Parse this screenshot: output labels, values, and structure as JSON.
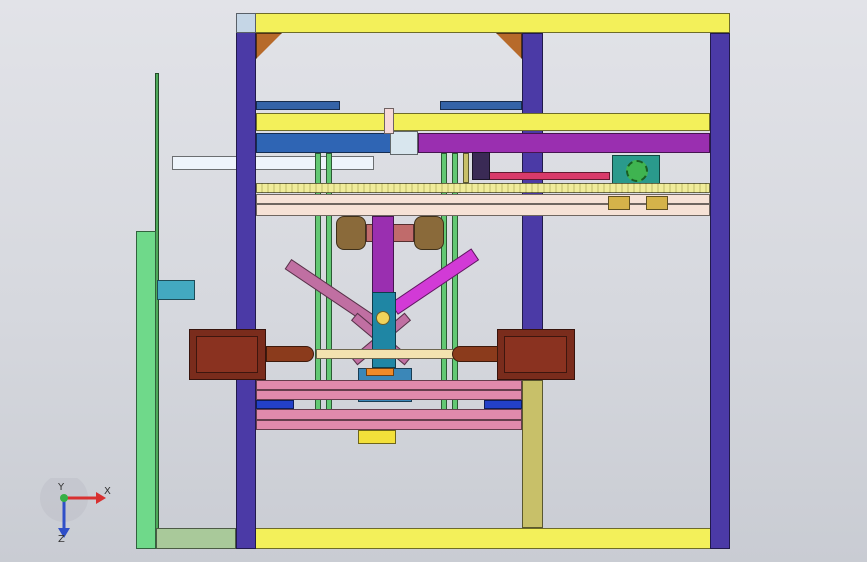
{
  "view": {
    "background_top": "#e2e3e8",
    "background_bottom": "#c9ccd3"
  },
  "colors": {
    "frame_beam": "#f3f05a",
    "frame_post": "#4b3aa6",
    "post_dark": "#2c2470",
    "rail_green": "#62c873",
    "rail_olive": "#c8c069",
    "rack": "#f0ec9a",
    "cream": "#f6e2d6",
    "blue_bar": "#2f65b4",
    "purple_bar": "#9a2fb0",
    "magenta_arm": "#d23ad6",
    "mauve_arm": "#c06fa2",
    "teal_block": "#1f86a4",
    "brown_box": "#7a2c1c",
    "pink_plate": "#e08aac",
    "gear_teal": "#2a9a8c",
    "gear_green": "#3fb450"
  },
  "axis_triad": {
    "x_label": "X",
    "y_label": "Y",
    "z_label": "Z",
    "x_color": "#d83030",
    "y_color": "#36b046",
    "z_color": "#2f4fc8"
  }
}
